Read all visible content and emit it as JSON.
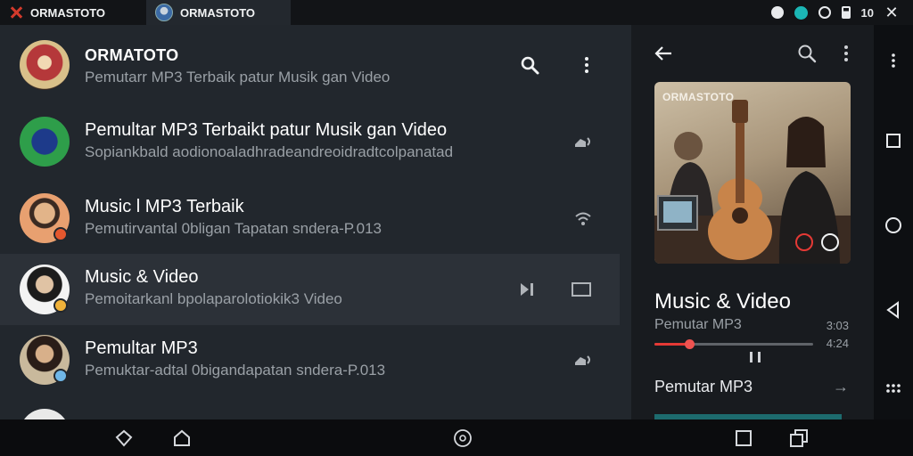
{
  "tabs": [
    {
      "label": "ORMASTOTO",
      "icon": "x-logo-icon"
    },
    {
      "label": "ORMASTOTO",
      "icon": "avatar-icon"
    }
  ],
  "status": {
    "time": "10"
  },
  "list": {
    "header": {
      "title": "ORMATOTO",
      "subtitle": "Pemutarr MP3 Terbaik patur Musik gan Video"
    },
    "rows": [
      {
        "title": "Pemultar MP3 Terbaikt patur Musik gan Video",
        "subtitle": "Sopiankbald aodionoaladhradeandreoidradtcolpanatad"
      },
      {
        "title": "Music l MP3 Terbaik",
        "subtitle": "Pemutirvantal 0bligan Tapatan sndera-P.013"
      },
      {
        "title": "Music & Video",
        "subtitle": "Pemoitarkanl bpolaparolotiokik3 Video"
      },
      {
        "title": "Pemultar MP3",
        "subtitle": "Pemuktar-adtal 0bigandapatan sndera-P.013"
      }
    ]
  },
  "player": {
    "art_label": "ORMASTOTO",
    "title": "Music & Video",
    "subtitle": "Pemutar MP3",
    "time_elapsed": "3:03",
    "time_total": "4:24",
    "progress": 0.22,
    "next_title": "Pemutar MP3"
  },
  "colors": {
    "accent": "#e53935",
    "panel": "#22272d",
    "selected": "#2c3138"
  }
}
